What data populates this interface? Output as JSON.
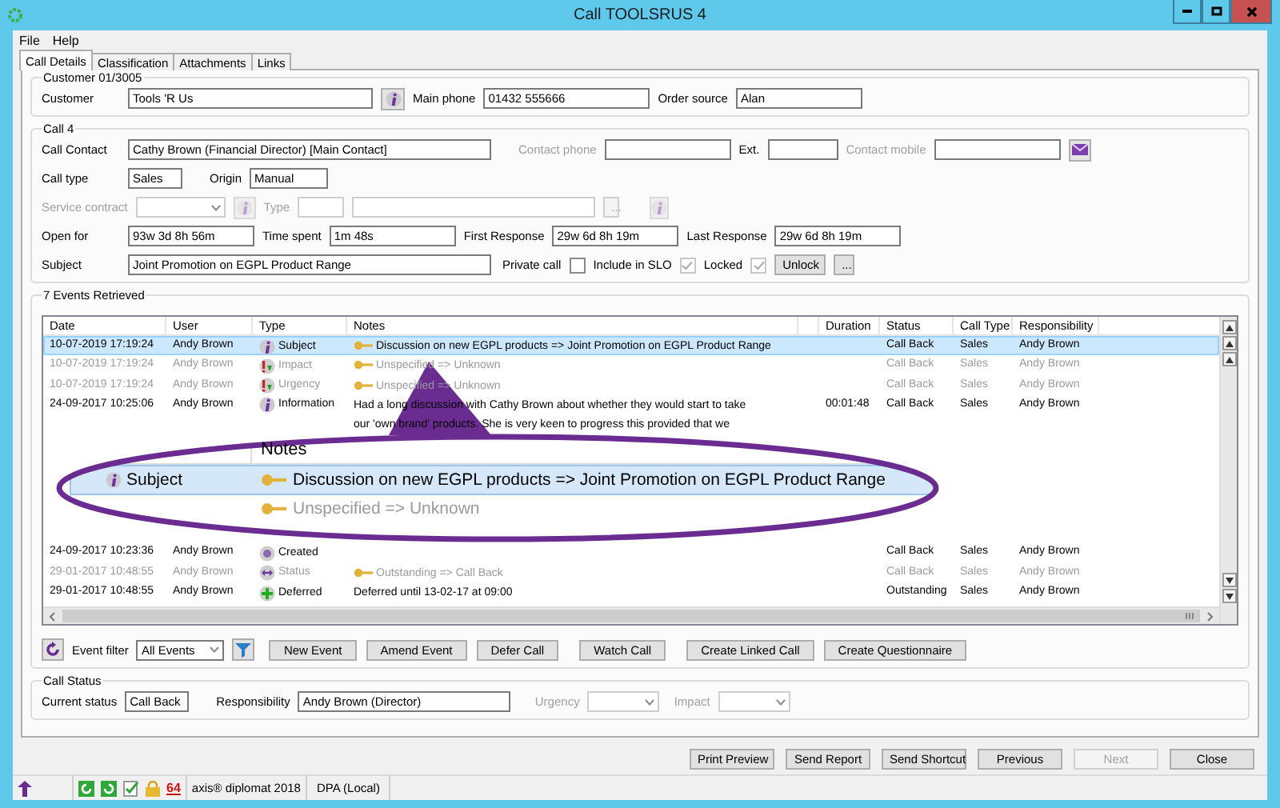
{
  "window": {
    "title": "Call TOOLSRUS 4"
  },
  "menu": [
    "File",
    "Help"
  ],
  "tabs": [
    {
      "label": "Call Details",
      "selected": true
    },
    {
      "label": "Classification",
      "selected": false
    },
    {
      "label": "Attachments",
      "selected": false
    },
    {
      "label": "Links",
      "selected": false
    }
  ],
  "customer_group": {
    "title": "Customer 01/3005",
    "rows": [
      [
        {
          "kind": "label",
          "text": "Customer"
        },
        {
          "kind": "input",
          "value": "Tools 'R Us"
        },
        {
          "kind": "info_button"
        },
        {
          "kind": "label",
          "text": "Main phone"
        },
        {
          "kind": "input",
          "value": "01432 555666"
        },
        {
          "kind": "label",
          "text": "Order source"
        },
        {
          "kind": "input",
          "value": "Alan"
        }
      ]
    ]
  },
  "call_group": {
    "title": "Call 4",
    "rows": [
      {
        "items": [
          {
            "kind": "label",
            "text": "Call Contact",
            "disabled": false
          },
          {
            "kind": "input",
            "value": "Cathy Brown (Financial Director) [Main Contact]",
            "disabled": false
          },
          {
            "kind": "label",
            "text": "Contact phone",
            "disabled": true
          },
          {
            "kind": "input",
            "disabled": false
          },
          {
            "kind": "label",
            "text": "Ext.",
            "disabled": false
          },
          {
            "kind": "input",
            "disabled": false
          },
          {
            "kind": "label",
            "text": "Contact mobile",
            "disabled": true
          },
          {
            "kind": "input",
            "disabled": false
          },
          {
            "kind": "mail_button",
            "disabled": false
          }
        ]
      },
      {
        "items": [
          {
            "kind": "label",
            "text": "Call type"
          },
          {
            "kind": "input",
            "value": "Sales"
          },
          {
            "kind": "label",
            "text": "Origin"
          },
          {
            "kind": "input",
            "value": "Manual"
          }
        ]
      },
      {
        "items": [
          {
            "kind": "label",
            "text": "Service contract",
            "disabled": true
          },
          {
            "kind": "select",
            "disabled": true
          },
          {
            "kind": "info_button",
            "disabled": true
          },
          {
            "kind": "label",
            "text": "Type",
            "disabled": true
          },
          {
            "kind": "input",
            "disabled": true
          },
          {
            "kind": "input",
            "disabled": true
          },
          {
            "kind": "button",
            "text": "...",
            "disabled": true
          },
          {
            "kind": "info_button",
            "disabled": true
          }
        ]
      },
      {
        "items": [
          {
            "kind": "label",
            "text": "Open for"
          },
          {
            "kind": "input",
            "value": "93w 3d 8h 56m"
          },
          {
            "kind": "label",
            "text": "Time spent"
          },
          {
            "kind": "input",
            "value": "1m 48s"
          },
          {
            "kind": "label",
            "text": "First Response"
          },
          {
            "kind": "input",
            "value": "29w 6d 8h 19m"
          },
          {
            "kind": "label",
            "text": "Last Response"
          },
          {
            "kind": "input",
            "value": "29w 6d 8h 19m"
          }
        ]
      },
      {
        "items": [
          {
            "kind": "label",
            "text": "Subject",
            "disabled": false
          },
          {
            "kind": "input",
            "value": "Joint Promotion on EGPL Product Range",
            "disabled": false
          },
          {
            "kind": "label",
            "text": "Private call",
            "disabled": false
          },
          {
            "kind": "checkbox",
            "checked": false,
            "disabled": false
          },
          {
            "kind": "label",
            "text": "Include in SLO",
            "disabled": false
          },
          {
            "kind": "checkbox",
            "checked": true,
            "disabled": true
          },
          {
            "kind": "label",
            "text": "Locked",
            "disabled": false
          },
          {
            "kind": "checkbox",
            "checked": true,
            "disabled": true
          },
          {
            "kind": "button",
            "text": "Unlock",
            "disabled": false
          },
          {
            "kind": "button",
            "text": "...",
            "disabled": false
          }
        ]
      }
    ]
  },
  "events": {
    "title": "7 Events Retrieved",
    "columns": [
      "Date",
      "User",
      "Type",
      "Notes",
      "Duration",
      "Status",
      "Call Type",
      "Responsibility"
    ],
    "rows": [
      {
        "date": "10-07-2019 17:19:24",
        "user": "Andy Brown",
        "type": "Subject",
        "kind": "info",
        "change": true,
        "notes": [
          "Discussion on new EGPL products => Joint Promotion on EGPL Product Range"
        ],
        "status": "Call Back",
        "call_type": "Sales",
        "responsibility": "Andy Brown",
        "selected": true,
        "greyed": false
      },
      {
        "date": "10-07-2019 17:19:24",
        "user": "Andy Brown",
        "type": "Impact",
        "kind": "alert",
        "change": true,
        "notes": [
          "Unspecified => Unknown"
        ],
        "status": "Call Back",
        "call_type": "Sales",
        "responsibility": "Andy Brown",
        "selected": false,
        "greyed": true
      },
      {
        "date": "10-07-2019 17:19:24",
        "user": "Andy Brown",
        "type": "Urgency",
        "kind": "alert",
        "change": true,
        "notes": [
          "Unspecified => Unknown"
        ],
        "status": "Call Back",
        "call_type": "Sales",
        "responsibility": "Andy Brown",
        "selected": false,
        "greyed": true
      },
      {
        "date": "24-09-2017 10:25:06",
        "user": "Andy Brown",
        "type": "Information",
        "kind": "info",
        "change": false,
        "notes": [
          "Had a long discussion with Cathy Brown about whether they would start to take",
          "our 'own brand' products. She is very keen to progress this provided that we"
        ],
        "duration": "00:01:48",
        "status": "Call Back",
        "call_type": "Sales",
        "responsibility": "Andy Brown",
        "selected": false,
        "greyed": false
      },
      {
        "kind": "gap"
      },
      {
        "date": "24-09-2017 10:23:36",
        "user": "Andy Brown",
        "type": "Created",
        "kind": "created",
        "change": false,
        "status": "Call Back",
        "call_type": "Sales",
        "responsibility": "Andy Brown",
        "selected": false,
        "greyed": false
      },
      {
        "date": "29-01-2017 10:48:55",
        "user": "Andy Brown",
        "type": "Status",
        "kind": "status",
        "change": true,
        "notes": [
          "Outstanding => Call Back"
        ],
        "status": "Call Back",
        "call_type": "Sales",
        "responsibility": "Andy Brown",
        "selected": false,
        "greyed": true
      },
      {
        "date": "29-01-2017 10:48:55",
        "user": "Andy Brown",
        "type": "Deferred",
        "kind": "deferred",
        "change": false,
        "notes": [
          "Deferred until 13-02-17 at 09:00"
        ],
        "status": "Outstanding",
        "call_type": "Sales",
        "responsibility": "Andy Brown",
        "selected": false,
        "greyed": false
      }
    ],
    "callout": {
      "header": "Notes",
      "rows": [
        {
          "type": "Subject",
          "kind": "info",
          "change": true,
          "note": "Discussion on new EGPL products => Joint Promotion on EGPL Product Range",
          "selected": true,
          "greyed": false
        },
        {
          "change": true,
          "note": "Unspecified => Unknown",
          "selected": false,
          "greyed": true
        }
      ]
    },
    "filter_label": "Event filter",
    "filter_value": "All Events",
    "buttons": [
      "New Event",
      "Amend Event",
      "Defer Call",
      "Watch Call",
      "Create Linked Call",
      "Create Questionnaire"
    ]
  },
  "status_group": {
    "title": "Call Status",
    "items": [
      {
        "kind": "label",
        "text": "Current status",
        "disabled": false
      },
      {
        "kind": "input",
        "value": "Call Back",
        "disabled": false
      },
      {
        "kind": "label",
        "text": "Responsibility",
        "disabled": false
      },
      {
        "kind": "input",
        "value": "Andy Brown (Director)",
        "disabled": false
      },
      {
        "kind": "label",
        "text": "Urgency",
        "disabled": true
      },
      {
        "kind": "select",
        "disabled": true
      },
      {
        "kind": "label",
        "text": "Impact",
        "disabled": true
      },
      {
        "kind": "select",
        "disabled": true
      }
    ]
  },
  "footer_buttons": [
    {
      "label": "Print Preview",
      "disabled": false
    },
    {
      "label": "Send Report",
      "disabled": false
    },
    {
      "label": "Send Shortcut",
      "disabled": false
    },
    {
      "label": "Previous",
      "disabled": false
    },
    {
      "label": "Next",
      "disabled": true
    },
    {
      "label": "Close",
      "disabled": false
    }
  ],
  "status_bar": {
    "badge": "64",
    "product": "axis® diplomat 2018",
    "database": "DPA (Local)"
  }
}
